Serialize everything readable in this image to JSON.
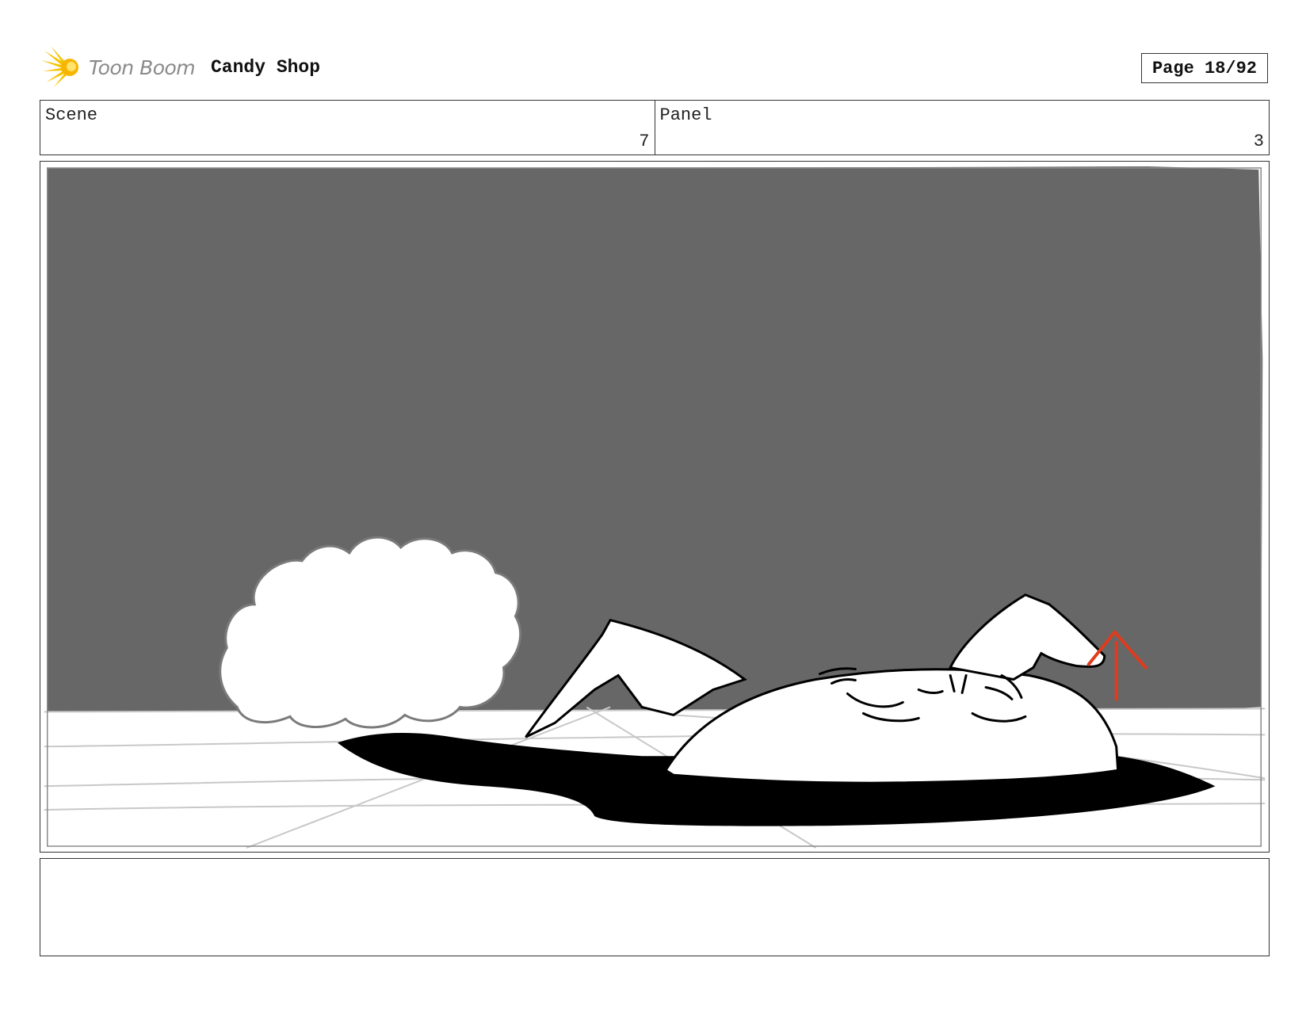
{
  "header": {
    "logo_text": "Toon Boom",
    "project_title": "Candy Shop",
    "page_label": "Page 18/92"
  },
  "info": {
    "scene_label": "Scene",
    "scene_value": "7",
    "panel_label": "Panel",
    "panel_value": "3"
  },
  "colors": {
    "sky": "#676767",
    "ground": "#ffffff",
    "shadow": "#000000",
    "arrow": "#e03b1c",
    "logo_flare": "#f5c400"
  },
  "notes": {
    "text": ""
  }
}
